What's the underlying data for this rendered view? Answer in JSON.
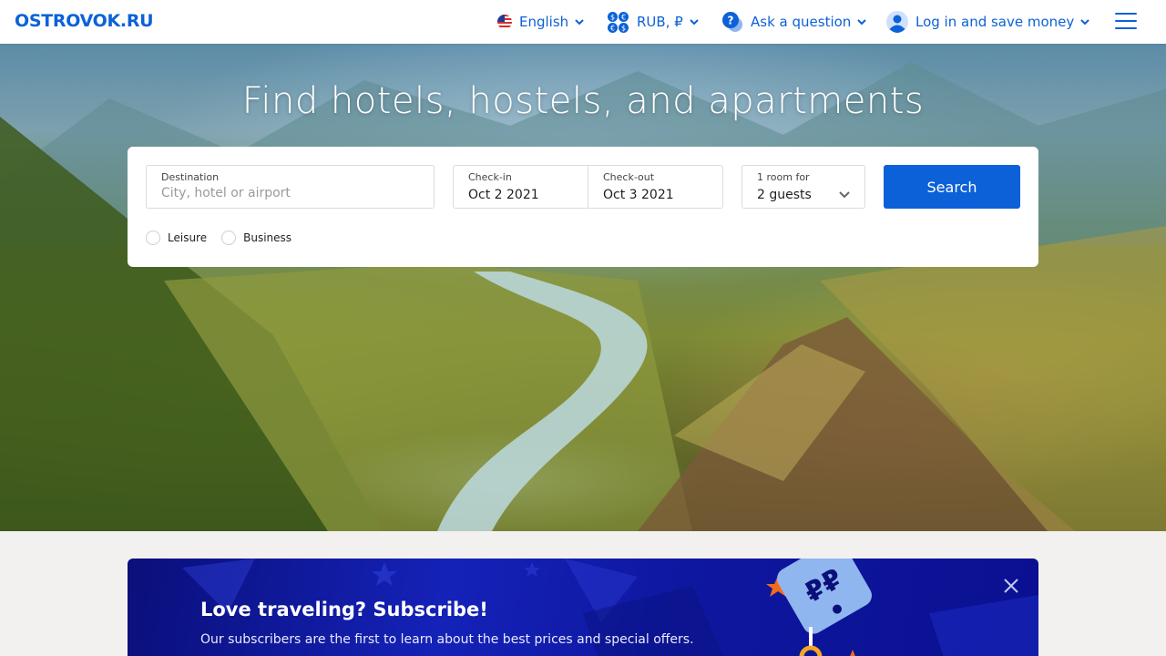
{
  "header": {
    "logo": "OSTROVOK.RU",
    "language": "English",
    "currency": "RUB, ₽",
    "help": "Ask a question",
    "login": "Log in and save money"
  },
  "hero": {
    "title": "Find hotels, hostels, and apartments"
  },
  "search": {
    "destination": {
      "label": "Destination",
      "placeholder": "City, hotel or airport",
      "value": ""
    },
    "checkin": {
      "label": "Check-in",
      "value": "Oct 2 2021"
    },
    "checkout": {
      "label": "Check-out",
      "value": "Oct 3 2021"
    },
    "guests": {
      "label": "1 room for",
      "value": "2 guests"
    },
    "submit": "Search",
    "trip_types": [
      {
        "label": "Leisure",
        "selected": false
      },
      {
        "label": "Business",
        "selected": false
      }
    ]
  },
  "banner": {
    "title": "Love traveling? Subscribe!",
    "subtitle": "Our subscribers are the first to learn about the best prices and special offers.",
    "tag_symbol": "₽₽"
  },
  "colors": {
    "accent": "#0c61d8",
    "banner": "#1522b8",
    "page_bg": "#f3f1ef"
  },
  "icons": [
    "us-flag-icon",
    "currency-icon",
    "question-chat-icon",
    "user-avatar-icon",
    "chevron-down-icon",
    "hamburger-menu-icon",
    "close-icon",
    "star-icon",
    "price-tag-icon"
  ]
}
